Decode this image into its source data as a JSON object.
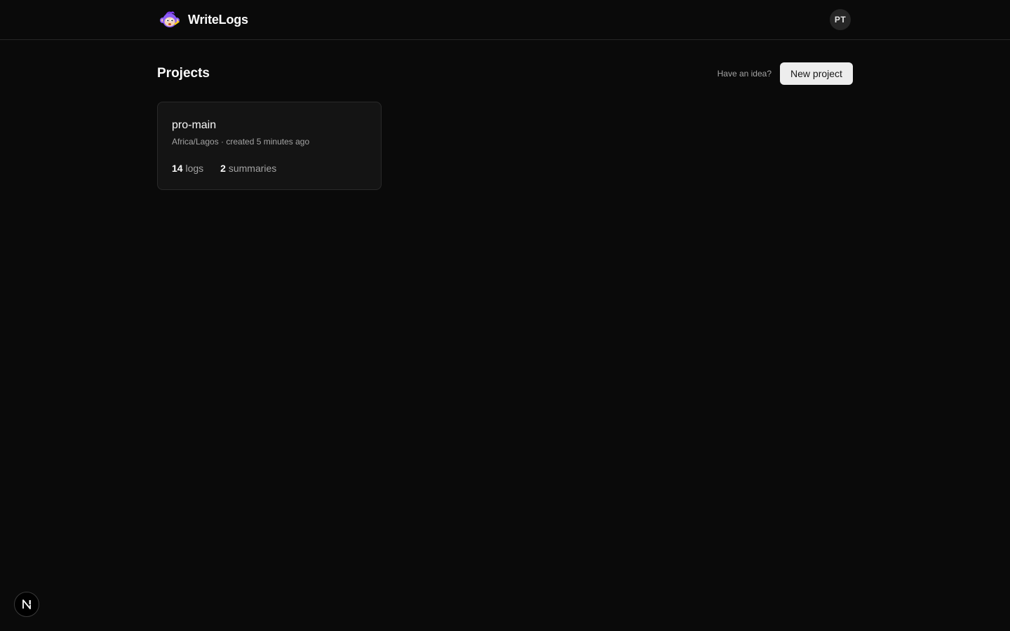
{
  "app": {
    "name": "WriteLogs",
    "logo_icon": "monkey-mascot-icon"
  },
  "header": {
    "avatar_initials": "PT"
  },
  "main": {
    "title": "Projects",
    "idea_prompt": "Have an idea?",
    "new_project_label": "New project",
    "projects": [
      {
        "name": "pro-main",
        "timezone": "Africa/Lagos",
        "separator": " · ",
        "created": "created 5 minutes ago",
        "logs_count": "14",
        "logs_label": "logs",
        "summaries_count": "2",
        "summaries_label": "summaries"
      }
    ]
  },
  "dev_badge": {
    "label": "N",
    "icon": "nextjs-icon"
  },
  "colors": {
    "background": "#0a0a0a",
    "card": "#141414",
    "border": "#262626",
    "primary_button": "#ededed",
    "mascot_purple": "#8b5cf6"
  }
}
